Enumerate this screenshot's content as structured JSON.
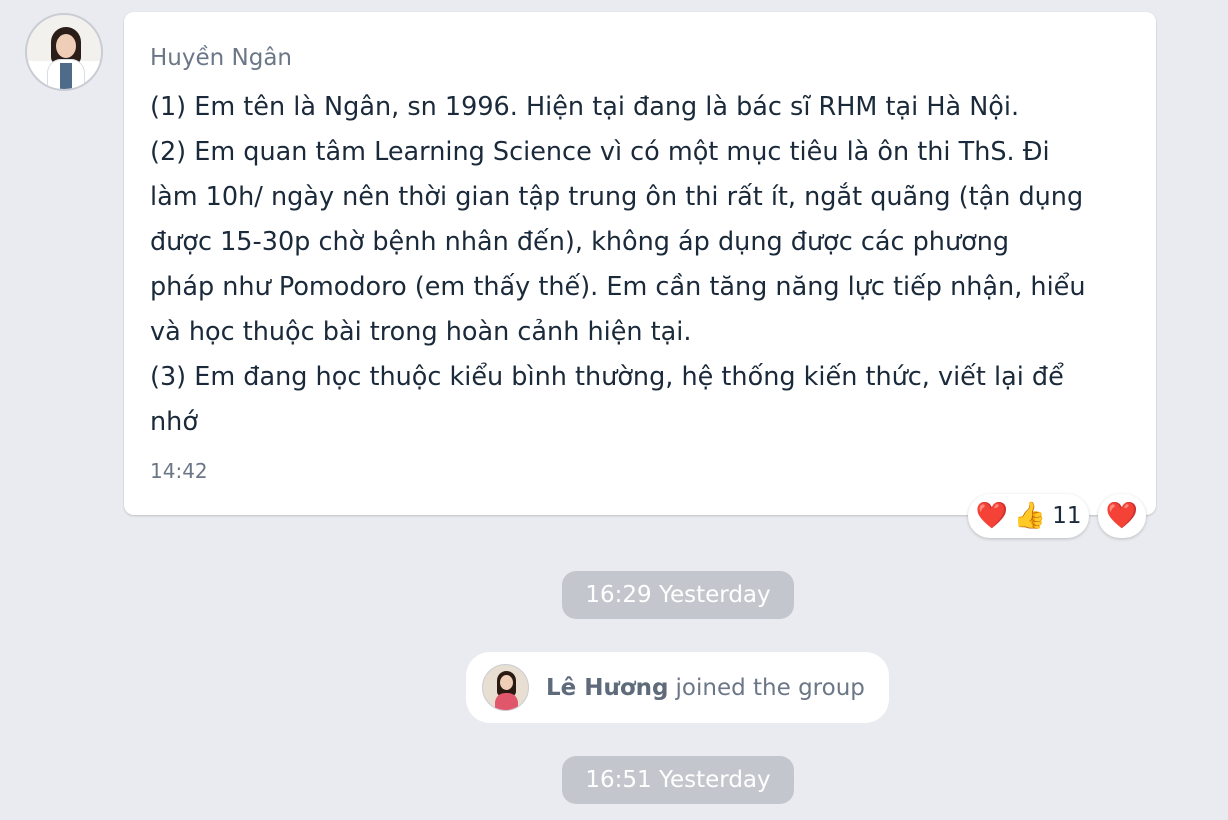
{
  "message": {
    "sender_name": "Huyền Ngân",
    "lines": [
      "(1) Em tên là Ngân, sn 1996. Hiện tại đang là bác sĩ RHM tại Hà Nội.",
      "(2) Em quan tâm Learning Science vì có một mục tiêu là ôn thi ThS. Đi",
      "làm 10h/ ngày nên thời gian tập trung ôn thi rất ít, ngắt quãng (tận dụng",
      "được 15-30p chờ bệnh nhân đến), không áp dụng được các phương",
      "pháp như Pomodoro (em thấy thế). Em cần tăng năng lực tiếp nhận, hiểu",
      "và học thuộc bài trong hoàn cảnh hiện tại.",
      "(3) Em đang học thuộc kiểu bình thường, hệ thống kiến thức, viết lại để",
      "nhớ"
    ],
    "time": "14:42"
  },
  "reactions": {
    "summary_icons": [
      "heart-icon",
      "thumbs-up-icon"
    ],
    "heart_glyph": "❤️",
    "thumbs_glyph": "👍",
    "count": "11",
    "own_reaction_glyph": "❤️"
  },
  "timeline": {
    "date_1": "16:29 Yesterday",
    "join_name": "Lê Hương",
    "join_text": "joined the group",
    "date_2": "16:51 Yesterday"
  },
  "colors": {
    "background": "#e9ebf0",
    "bubble": "#ffffff",
    "date_pill": "#c3c7cd",
    "heart": "#e0243b"
  }
}
